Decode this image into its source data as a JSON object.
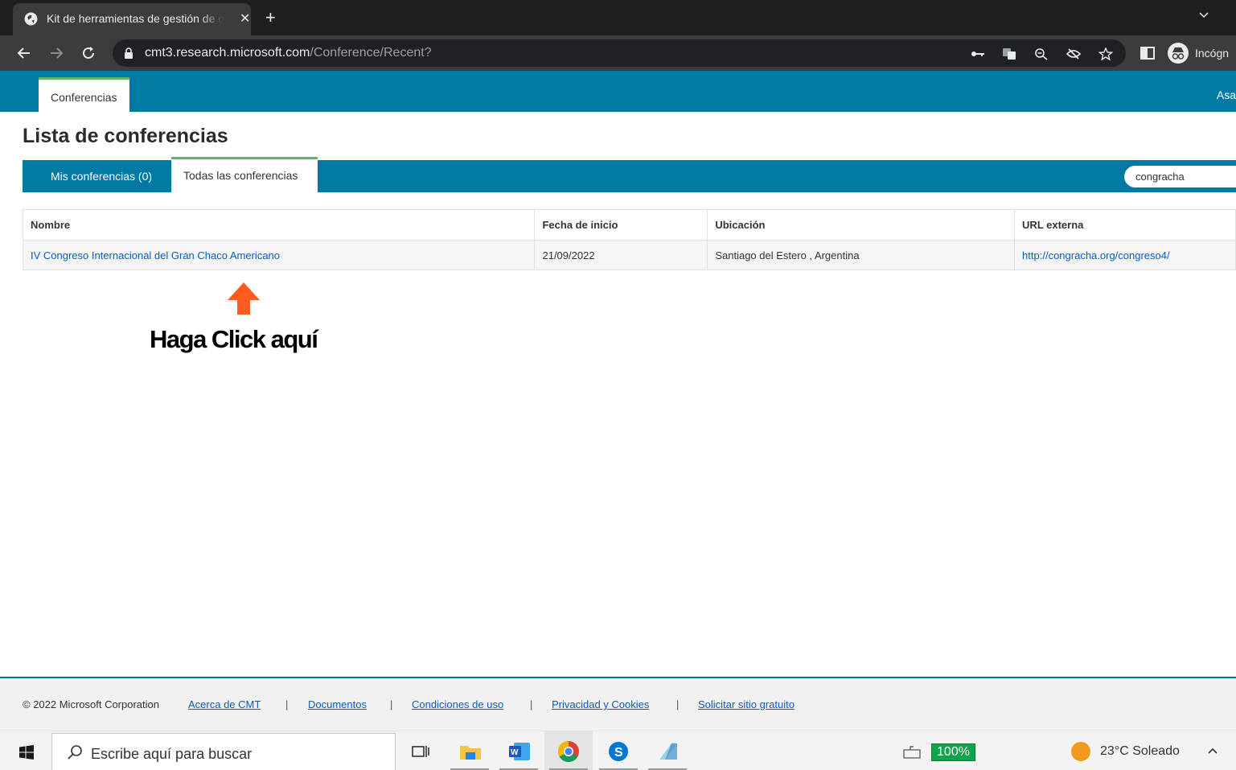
{
  "browser": {
    "tab_title": "Kit de herramientas de gestión de conferencias",
    "tab_close": "✕",
    "new_tab": "+",
    "url_host": "cmt3.research.microsoft.com",
    "url_path": "/Conference/Recent?",
    "profile_label": "Incógn"
  },
  "site": {
    "nav_tab": "Conferencias",
    "nav_right": "Asa"
  },
  "page": {
    "title": "Lista de conferencias",
    "tab_mine": "Mis conferencias (0)",
    "tab_all": "Todas las conferencias",
    "search_value": "congracha"
  },
  "table": {
    "headers": [
      "Nombre",
      "Fecha de inicio",
      "Ubicación",
      "URL externa"
    ],
    "rows": [
      {
        "name": "IV Congreso Internacional del Gran Chaco Americano",
        "start_date": "21/09/2022",
        "location": "Santiago del Estero , Argentina",
        "url": "http://congracha.org/congreso4/"
      }
    ]
  },
  "annotation": {
    "text": "Haga Click aquí",
    "color": "#ff5a1f"
  },
  "footer": {
    "copyright": "© 2022 Microsoft Corporation",
    "links": [
      "Acerca de CMT",
      "Documentos",
      "Condiciones de uso",
      "Privacidad y Cookies",
      "Solicitar sitio gratuito"
    ],
    "separator": "|"
  },
  "taskbar": {
    "search_placeholder": "Escribe aquí para buscar",
    "battery": "100%",
    "weather": "23°C  Soleado",
    "apps": [
      "task-view-icon",
      "file-explorer-icon",
      "word-icon",
      "chrome-icon",
      "skype-icon",
      "notepad-icon"
    ]
  },
  "colors": {
    "brand": "#0079a3",
    "active_tab_accent": "#5cb85c",
    "link": "#0a5cbf"
  }
}
